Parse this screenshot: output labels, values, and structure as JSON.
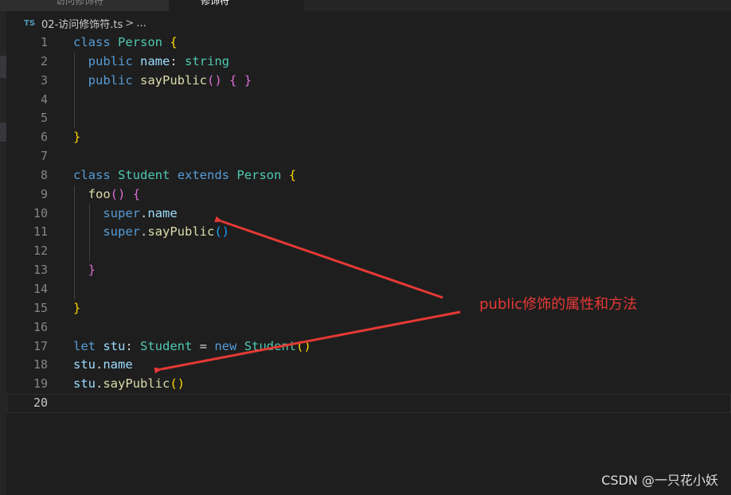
{
  "tabs": [
    {
      "label": "访问修饰符"
    },
    {
      "label": "修饰符"
    }
  ],
  "breadcrumb": {
    "icon": "TS",
    "file": "02-访问修饰符.ts",
    "separator": ">",
    "more": "..."
  },
  "editor": {
    "lines": [
      {
        "n": "1",
        "tokens": [
          {
            "t": "class",
            "c": "k"
          },
          {
            "t": " "
          },
          {
            "t": "Person",
            "c": "c"
          },
          {
            "t": " "
          },
          {
            "t": "{",
            "c": "p1"
          }
        ]
      },
      {
        "n": "2",
        "tokens": [
          {
            "t": "  "
          },
          {
            "t": "public",
            "c": "k"
          },
          {
            "t": " "
          },
          {
            "t": "name",
            "c": "v"
          },
          {
            "t": ": "
          },
          {
            "t": "string",
            "c": "c"
          }
        ]
      },
      {
        "n": "3",
        "tokens": [
          {
            "t": "  "
          },
          {
            "t": "public",
            "c": "k"
          },
          {
            "t": " "
          },
          {
            "t": "sayPublic",
            "c": "f"
          },
          {
            "t": "()",
            "c": "p2"
          },
          {
            "t": " "
          },
          {
            "t": "{ }",
            "c": "p2"
          }
        ]
      },
      {
        "n": "4",
        "tokens": []
      },
      {
        "n": "5",
        "tokens": []
      },
      {
        "n": "6",
        "tokens": [
          {
            "t": "}",
            "c": "p1"
          }
        ]
      },
      {
        "n": "7",
        "tokens": []
      },
      {
        "n": "8",
        "tokens": [
          {
            "t": "class",
            "c": "k"
          },
          {
            "t": " "
          },
          {
            "t": "Student",
            "c": "c"
          },
          {
            "t": " "
          },
          {
            "t": "extends",
            "c": "k"
          },
          {
            "t": " "
          },
          {
            "t": "Person",
            "c": "c"
          },
          {
            "t": " "
          },
          {
            "t": "{",
            "c": "p1"
          }
        ]
      },
      {
        "n": "9",
        "tokens": [
          {
            "t": "  "
          },
          {
            "t": "foo",
            "c": "f"
          },
          {
            "t": "()",
            "c": "p2"
          },
          {
            "t": " "
          },
          {
            "t": "{",
            "c": "p2"
          }
        ]
      },
      {
        "n": "10",
        "tokens": [
          {
            "t": "    "
          },
          {
            "t": "super",
            "c": "k"
          },
          {
            "t": "."
          },
          {
            "t": "name",
            "c": "v"
          }
        ]
      },
      {
        "n": "11",
        "tokens": [
          {
            "t": "    "
          },
          {
            "t": "super",
            "c": "k"
          },
          {
            "t": "."
          },
          {
            "t": "sayPublic",
            "c": "f"
          },
          {
            "t": "()",
            "c": "p3"
          }
        ]
      },
      {
        "n": "12",
        "tokens": []
      },
      {
        "n": "13",
        "tokens": [
          {
            "t": "  "
          },
          {
            "t": "}",
            "c": "p2"
          }
        ]
      },
      {
        "n": "14",
        "tokens": []
      },
      {
        "n": "15",
        "tokens": [
          {
            "t": "}",
            "c": "p1"
          }
        ]
      },
      {
        "n": "16",
        "tokens": []
      },
      {
        "n": "17",
        "tokens": [
          {
            "t": "let",
            "c": "k"
          },
          {
            "t": " "
          },
          {
            "t": "stu",
            "c": "v"
          },
          {
            "t": ": "
          },
          {
            "t": "Student",
            "c": "c"
          },
          {
            "t": " = "
          },
          {
            "t": "new",
            "c": "k"
          },
          {
            "t": " "
          },
          {
            "t": "Student",
            "c": "c"
          },
          {
            "t": "()",
            "c": "p1"
          }
        ]
      },
      {
        "n": "18",
        "tokens": [
          {
            "t": "stu",
            "c": "v"
          },
          {
            "t": "."
          },
          {
            "t": "name",
            "c": "v"
          }
        ]
      },
      {
        "n": "19",
        "tokens": [
          {
            "t": "stu",
            "c": "v"
          },
          {
            "t": "."
          },
          {
            "t": "sayPublic",
            "c": "f"
          },
          {
            "t": "()",
            "c": "p1"
          }
        ]
      },
      {
        "n": "20",
        "tokens": []
      }
    ],
    "current_line": "20"
  },
  "annotation": {
    "text": "public修饰的属性和方法",
    "color": "#e53935"
  },
  "watermark": "CSDN @一只花小妖"
}
